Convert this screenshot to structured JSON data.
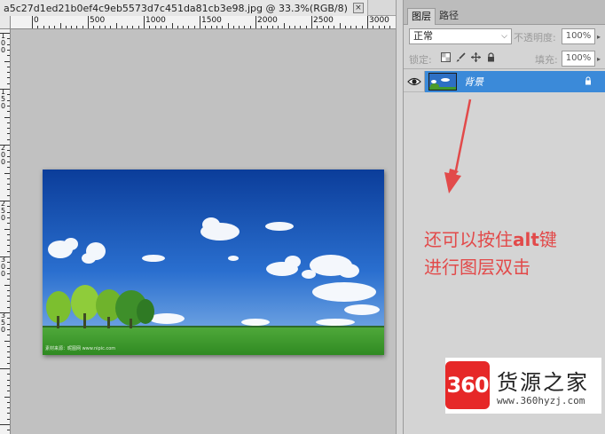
{
  "document": {
    "tab_title": "a5c27d1ed21b0ef4c9eb5573d7c451da81cb3e98.jpg @ 33.3%(RGB/8)",
    "close_glyph": "×",
    "ruler_h_labels": [
      "0",
      "500",
      "1000",
      "1500",
      "2000",
      "2500",
      "3000"
    ],
    "ruler_v_labels": [
      "1 0 0",
      "1 5 0",
      "2 0 0",
      "2 5 0",
      "3 0 0",
      "3 5 0"
    ],
    "image_watermark": "素材来源：昵图网 www.nipic.com"
  },
  "layers_panel": {
    "tabs": [
      {
        "label": "图层"
      },
      {
        "label": "路径"
      }
    ],
    "blend_mode": "正常",
    "opacity_label": "不透明度:",
    "opacity_value": "100%",
    "lock_label": "锁定:",
    "fill_label": "填充:",
    "fill_value": "100%",
    "layer": {
      "name": "背景"
    }
  },
  "annotation": {
    "line1_prefix": "还可以按住",
    "line1_key": "alt",
    "line1_suffix": "键",
    "line2": "进行图层双击"
  },
  "logo": {
    "mark": "360",
    "title": "货源之家",
    "url": "www.360hyzj.com"
  },
  "colors": {
    "selection": "#3b8ad9",
    "annotation": "#e24a4a",
    "logo_red": "#e62828"
  }
}
